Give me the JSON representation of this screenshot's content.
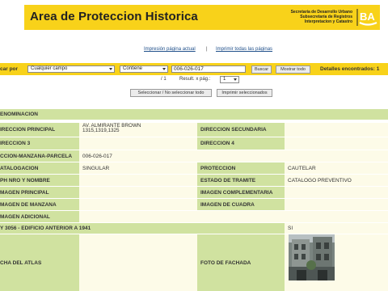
{
  "header": {
    "title": "Area de Proteccion Historica",
    "org_lines": [
      "Secretaría de Desarrollo Urbano",
      "Subsecretaría de Registros",
      "Interpretacion y Catastro"
    ],
    "logo_text": "BA",
    "brand_color": "#f8d21a"
  },
  "print_links": {
    "current_page": "Impresión página actual",
    "separator": "|",
    "all_pages": "Imprimir todas las páginas"
  },
  "search": {
    "label": "car por",
    "field_select": "Cualquier campo",
    "operator_select": "Contiene",
    "query_value": "006-026-017",
    "search_button": "Buscar",
    "show_all_button": "Mostrar todo",
    "results_label": "Detalles encontrados: 1"
  },
  "pagination": {
    "page_text": "/ 1",
    "per_page_label": "Result. x pág.:",
    "per_page_value": "1"
  },
  "selection": {
    "toggle_button": "Seleccionar / No seleccionar todo",
    "print_selected_button": "Imprimir seleccionados"
  },
  "record": {
    "denominacion_label": "ENOMINACION",
    "direccion_principal_label": "IRECCION PRINCIPAL",
    "direccion_principal_line1": "AV. ALMIRANTE BROWN",
    "direccion_principal_line2": "1315,1319,1325",
    "direccion_secundaria_label": "DIRECCION SECUNDARIA",
    "direccion3_label": "IRECCION 3",
    "direccion4_label": "DIRECCION 4",
    "smp_label": "CCION-MANZANA-PARCELA",
    "smp_value": "006-026-017",
    "catalogacion_label": "ATALOGACION",
    "catalogacion_value": "SINGULAR",
    "proteccion_label": "PROTECCION",
    "proteccion_value": "CAUTELAR",
    "ph_label": "PH Nro y NOMBRE",
    "estado_label": "ESTADO de TRAMITE",
    "estado_value": "CATALOGO PREVENTIVO",
    "imagen_principal_label": "MAGEN PRINCIPAL",
    "imagen_complementaria_label": "IMAGEN COMPLEMENTARIA",
    "imagen_manzana_label": "MAGEN de MANZANA",
    "imagen_cuadra_label": "IMAGEN de CUADRA",
    "imagen_adicional_label": "MAGEN ADICIONAL",
    "ley_label": "Y 3056 - Edificio Anterior a 1941",
    "ley_value": "SI",
    "ficha_label": "CHA del ATLAS",
    "foto_fachada_label": "FOTO de FACHADA"
  }
}
